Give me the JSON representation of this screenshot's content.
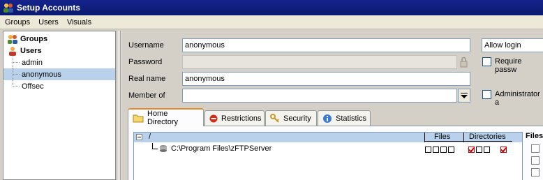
{
  "window": {
    "title": "Setup Accounts"
  },
  "menu": [
    "Groups",
    "Users",
    "Visuals"
  ],
  "tree": {
    "groups_label": "Groups",
    "users_label": "Users",
    "users": [
      "admin",
      "anonymous",
      "Offsec"
    ],
    "selected": "anonymous"
  },
  "form": {
    "username_label": "Username",
    "username_value": "anonymous",
    "password_label": "Password",
    "password_value": "",
    "realname_label": "Real name",
    "realname_value": "anonymous",
    "memberof_label": "Member of",
    "memberof_value": "",
    "login_select": "Allow login",
    "require_password_label": "Require passw",
    "administrator_label": "Administrator a"
  },
  "tabs": [
    "Home Directory",
    "Restrictions",
    "Security",
    "Statistics"
  ],
  "active_tab": "Home Directory",
  "directory": {
    "root": "/",
    "files_header": "Files",
    "directories_header": "Directories",
    "entry_path": "C:\\Program Files\\zFTPServer",
    "files_perms": [
      false,
      false,
      false,
      false
    ],
    "dir_perms": [
      true,
      false,
      false,
      true
    ]
  },
  "side_label": "Files",
  "colors": {
    "title_bg": "#0a1a6e",
    "selection": "#b9d1ea",
    "tab_accent": "#e68b2c"
  }
}
